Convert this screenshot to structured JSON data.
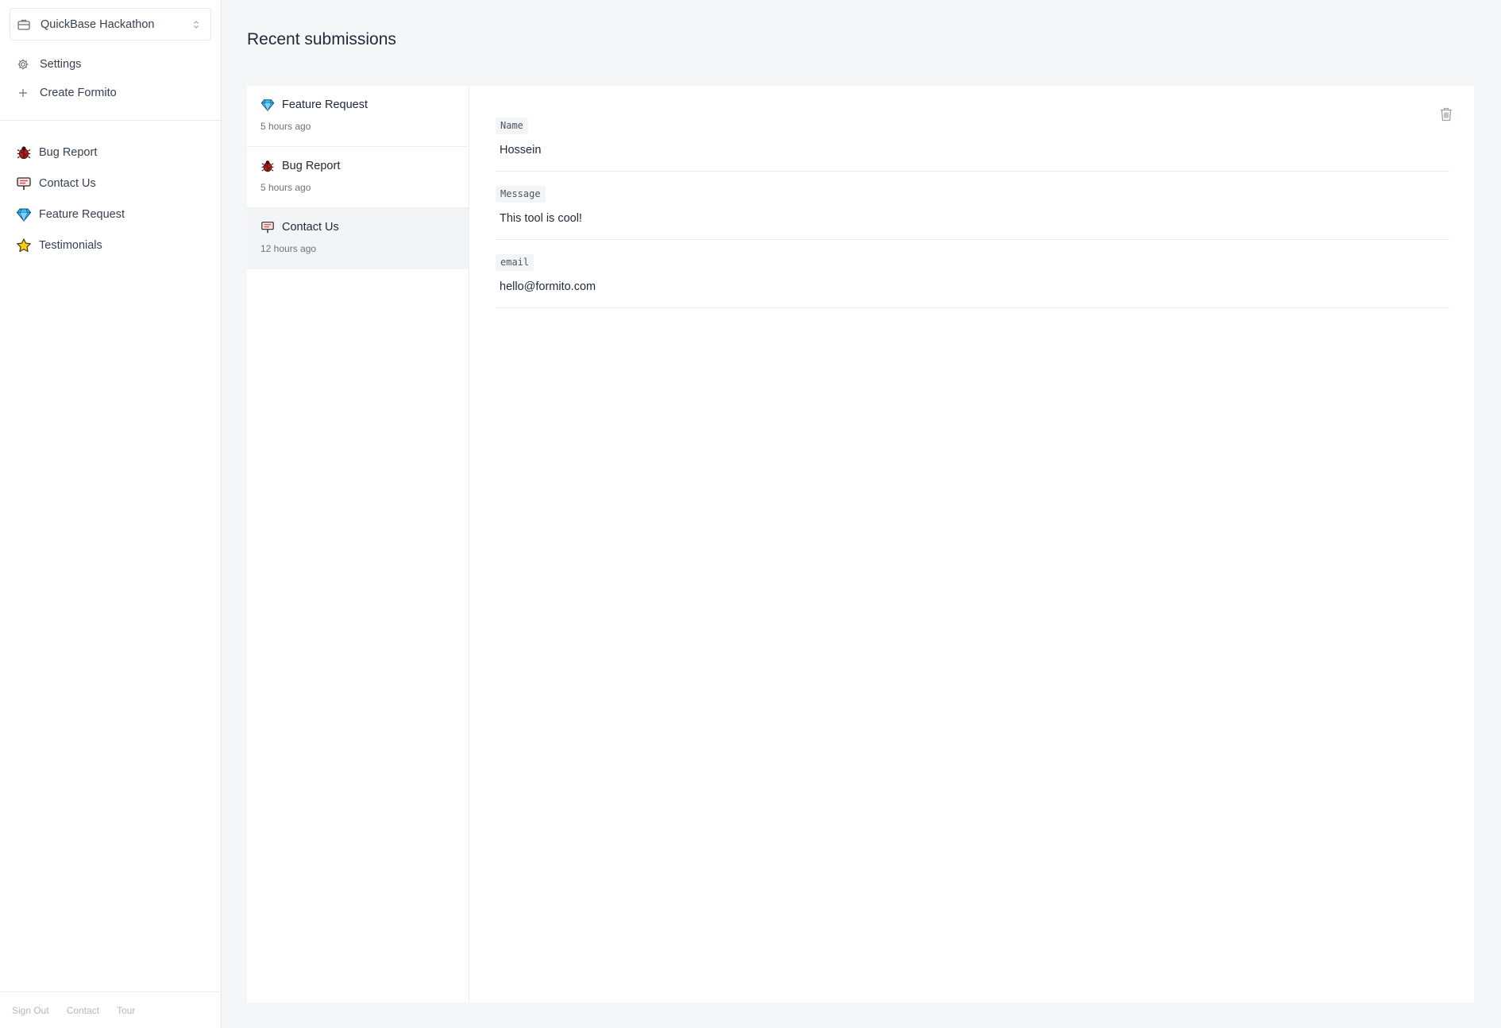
{
  "sidebar": {
    "workspace": {
      "name": "QuickBase Hackathon",
      "icon": "briefcase-icon"
    },
    "nav": [
      {
        "label": "Settings",
        "icon": "gear-icon"
      },
      {
        "label": "Create Formito",
        "icon": "plus-icon"
      }
    ],
    "forms": [
      {
        "label": "Bug Report",
        "icon": "bug-icon"
      },
      {
        "label": "Contact Us",
        "icon": "sign-icon"
      },
      {
        "label": "Feature Request",
        "icon": "gem-icon"
      },
      {
        "label": "Testimonials",
        "icon": "star-icon"
      }
    ],
    "footer": {
      "sign_out": "Sign Out",
      "contact": "Contact",
      "tour": "Tour"
    }
  },
  "main": {
    "title": "Recent submissions",
    "submissions": [
      {
        "title": "Feature Request",
        "time": "5 hours ago",
        "icon": "gem-icon"
      },
      {
        "title": "Bug Report",
        "time": "5 hours ago",
        "icon": "bug-icon"
      },
      {
        "title": "Contact Us",
        "time": "12 hours ago",
        "icon": "sign-icon",
        "selected": true
      }
    ],
    "detail": {
      "fields": [
        {
          "label": "Name",
          "value": "Hossein"
        },
        {
          "label": "Message",
          "value": "This tool is cool!"
        },
        {
          "label": "email",
          "value": "hello@formito.com"
        }
      ]
    }
  }
}
